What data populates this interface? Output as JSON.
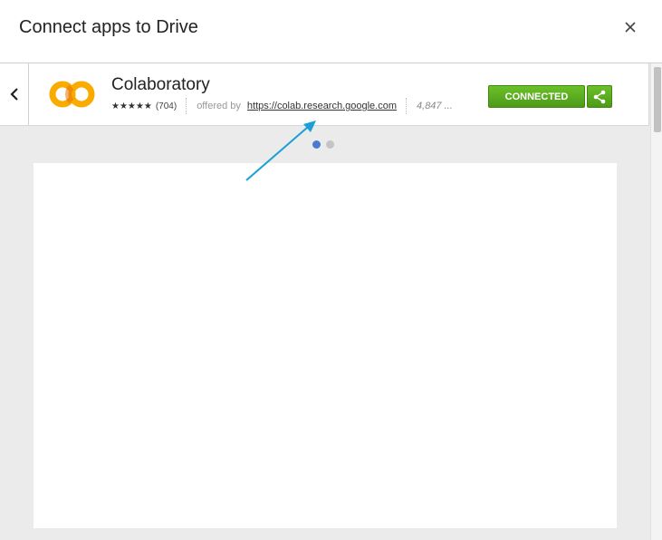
{
  "dialog": {
    "title": "Connect apps to Drive",
    "close_symbol": "×"
  },
  "app": {
    "name": "Colaboratory",
    "stars": "★★★★★",
    "rating_count": "(704)",
    "offered_by_label": "offered by",
    "offered_by_link": "https://colab.research.google.com",
    "users": "4,847 ...",
    "connected_label": "CONNECTED",
    "logo_text": "CO",
    "logo_color": "#f9ab00",
    "button_color": "#56a91e"
  },
  "carousel": {
    "page_count": 2,
    "active_index": 0,
    "active_color": "#4a7bd0"
  },
  "annotation": {
    "arrow_color": "#1a9fd6",
    "icon": "arrow-annotation"
  }
}
